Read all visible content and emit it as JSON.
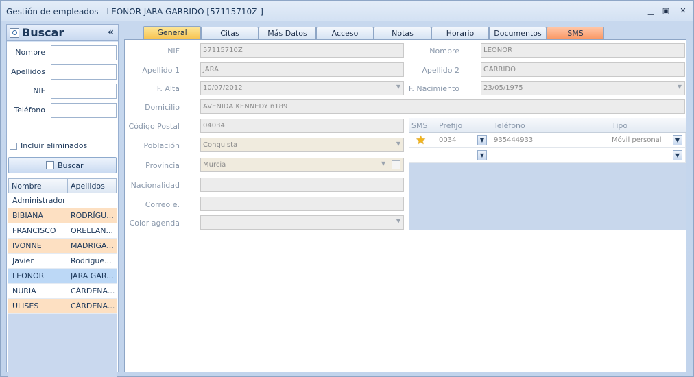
{
  "window": {
    "title": "Gestión de empleados - LEONOR JARA GARRIDO  [57115710Z ]"
  },
  "search": {
    "title": "Buscar",
    "collapse": "«",
    "labels": {
      "nombre": "Nombre",
      "apellidos": "Apellidos",
      "nif": "NIF",
      "telefono": "Teléfono"
    },
    "values": {
      "nombre": "",
      "apellidos": "",
      "nif": "",
      "telefono": ""
    },
    "include_deleted": "Incluir eliminados",
    "button": "Buscar",
    "columns": [
      "Nombre",
      "Apellidos"
    ],
    "rows": [
      {
        "nombre": "Administrador",
        "apellidos": "",
        "style": "white"
      },
      {
        "nombre": "BIBIANA",
        "apellidos": "RODRÍGU...",
        "style": "orange"
      },
      {
        "nombre": "FRANCISCO",
        "apellidos": "ORELLAN...",
        "style": "white"
      },
      {
        "nombre": "IVONNE",
        "apellidos": "MADRIGA...",
        "style": "orange"
      },
      {
        "nombre": "Javier",
        "apellidos": "Rodrigue...",
        "style": "white"
      },
      {
        "nombre": "LEONOR",
        "apellidos": "JARA GAR...",
        "style": "sel"
      },
      {
        "nombre": "NURIA",
        "apellidos": "CÁRDENA...",
        "style": "white"
      },
      {
        "nombre": "ULISES",
        "apellidos": "CÁRDENA...",
        "style": "orange"
      }
    ]
  },
  "tabs": [
    "General",
    "Citas",
    "Más Datos",
    "Acceso",
    "Notas",
    "Horario",
    "Documentos",
    "SMS"
  ],
  "form": {
    "labels": {
      "nif": "NIF",
      "nombre": "Nombre",
      "apellido1": "Apellido 1",
      "apellido2": "Apellido 2",
      "falta": "F. Alta",
      "fnac": "F. Nacimiento",
      "domicilio": "Domicilio",
      "cp": "Código Postal",
      "poblacion": "Población",
      "provincia": "Provincia",
      "nacionalidad": "Nacionalidad",
      "correo": "Correo e.",
      "color": "Color agenda"
    },
    "values": {
      "nif": "57115710Z",
      "nombre": "LEONOR",
      "apellido1": "JARA",
      "apellido2": "GARRIDO",
      "falta": "10/07/2012",
      "fnac": "23/05/1975",
      "domicilio": "AVENIDA KENNEDY n189",
      "cp": "04034",
      "poblacion": "Conquista",
      "provincia": "Murcia",
      "nacionalidad": "",
      "correo": "",
      "color": ""
    }
  },
  "phones": {
    "columns": [
      "SMS",
      "Prefijo",
      "Teléfono",
      "Tipo"
    ],
    "rows": [
      {
        "prefijo": "0034",
        "telefono": "935444933",
        "tipo": "Móvil personal"
      },
      {
        "prefijo": "",
        "telefono": "",
        "tipo": ""
      }
    ]
  }
}
